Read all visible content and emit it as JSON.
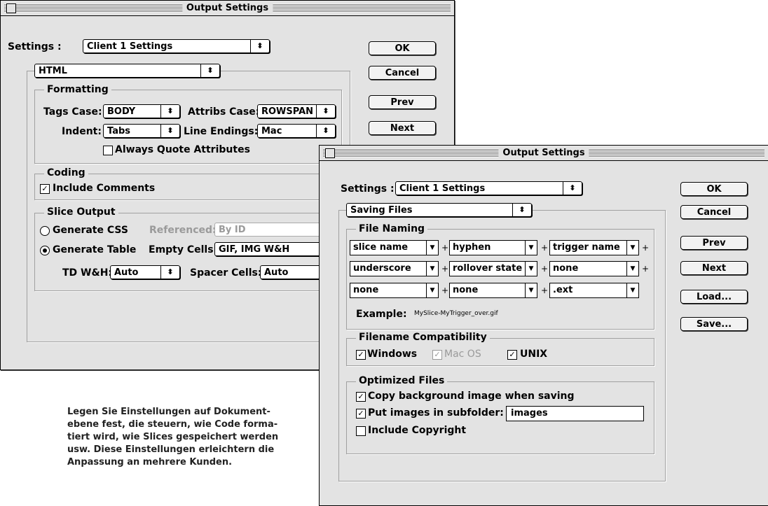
{
  "back_window": {
    "title": "Output Settings",
    "settings_label": "Settings :",
    "settings_value": "Client 1 Settings",
    "section_value": "HTML",
    "buttons": {
      "ok": "OK",
      "cancel": "Cancel",
      "prev": "Prev",
      "next": "Next"
    },
    "formatting": {
      "title": "Formatting",
      "tags_case_label": "Tags Case:",
      "tags_case_value": "BODY",
      "attribs_case_label": "Attribs Case:",
      "attribs_case_value": "ROWSPAN",
      "indent_label": "Indent:",
      "indent_value": "Tabs",
      "line_endings_label": "Line Endings:",
      "line_endings_value": "Mac",
      "always_quote_label": "Always Quote Attributes"
    },
    "coding": {
      "title": "Coding",
      "include_comments_label": "Include Comments"
    },
    "slice_output": {
      "title": "Slice Output",
      "generate_css_label": "Generate CSS",
      "referenced_label": "Referenced:",
      "referenced_value": "By ID",
      "generate_table_label": "Generate Table",
      "empty_cells_label": "Empty Cells:",
      "empty_cells_value": "GIF, IMG W&H",
      "td_wh_label": "TD W&H:",
      "td_wh_value": "Auto",
      "spacer_cells_label": "Spacer Cells:",
      "spacer_cells_value": "Auto"
    }
  },
  "front_window": {
    "title": "Output Settings",
    "settings_label": "Settings :",
    "settings_value": "Client 1 Settings",
    "section_value": "Saving Files",
    "buttons": {
      "ok": "OK",
      "cancel": "Cancel",
      "prev": "Prev",
      "next": "Next",
      "load": "Load...",
      "save": "Save..."
    },
    "file_naming": {
      "title": "File Naming",
      "rows": [
        [
          "slice name",
          "hyphen",
          "trigger name"
        ],
        [
          "underscore",
          "rollover state",
          "none"
        ],
        [
          "none",
          "none",
          ".ext"
        ]
      ],
      "plus": "+",
      "example_label": "Example:",
      "example_value": "MySlice-MyTrigger_over.gif"
    },
    "compat": {
      "title": "Filename Compatibility",
      "windows_label": "Windows",
      "macos_label": "Mac OS",
      "unix_label": "UNIX"
    },
    "optimized": {
      "title": "Optimized Files",
      "copy_bg_label": "Copy background image when saving",
      "subfolder_label": "Put images in subfolder:",
      "subfolder_value": "images",
      "copyright_label": "Include Copyright"
    }
  },
  "caption": {
    "lines": [
      "Legen Sie Einstellungen auf Dokument-",
      "ebene fest, die steuern, wie Code forma-",
      "tiert wird, wie Slices gespeichert werden",
      "usw. Diese Einstellungen erleichtern die",
      "Anpassung an mehrere Kunden."
    ]
  },
  "glyphs": {
    "popup_arrow": "⬍",
    "dropdown": "▼",
    "check": "✓"
  }
}
